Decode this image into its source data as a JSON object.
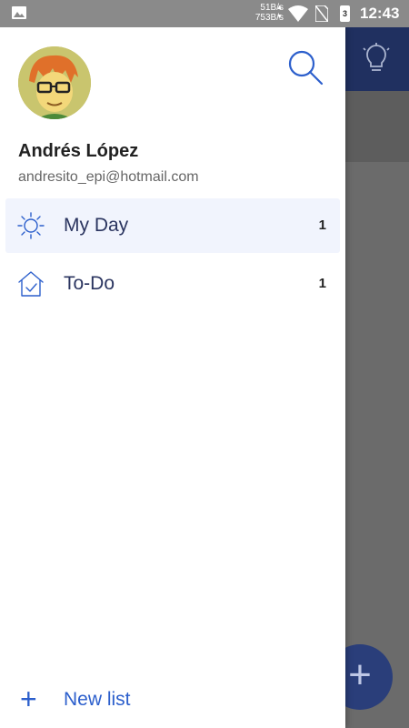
{
  "status_bar": {
    "net_up": "51B/s",
    "net_down": "753B/s",
    "battery_label": "3",
    "time": "12:43",
    "icons": [
      "image-icon",
      "wifi-icon",
      "no-sim-icon",
      "battery-icon"
    ]
  },
  "drawer": {
    "user": {
      "name": "Andrés López",
      "email": "andresito_epi@hotmail.com"
    },
    "nav_items": [
      {
        "label": "My Day",
        "count": "1",
        "icon": "sun-icon",
        "active": true
      },
      {
        "label": "To-Do",
        "count": "1",
        "icon": "home-check-icon",
        "active": false
      }
    ],
    "new_list": {
      "label": "New list",
      "icon": "plus-icon"
    }
  },
  "colors": {
    "accent": "#2c5fcc",
    "active_bg": "#f1f4fd",
    "header_bg": "#203060"
  }
}
